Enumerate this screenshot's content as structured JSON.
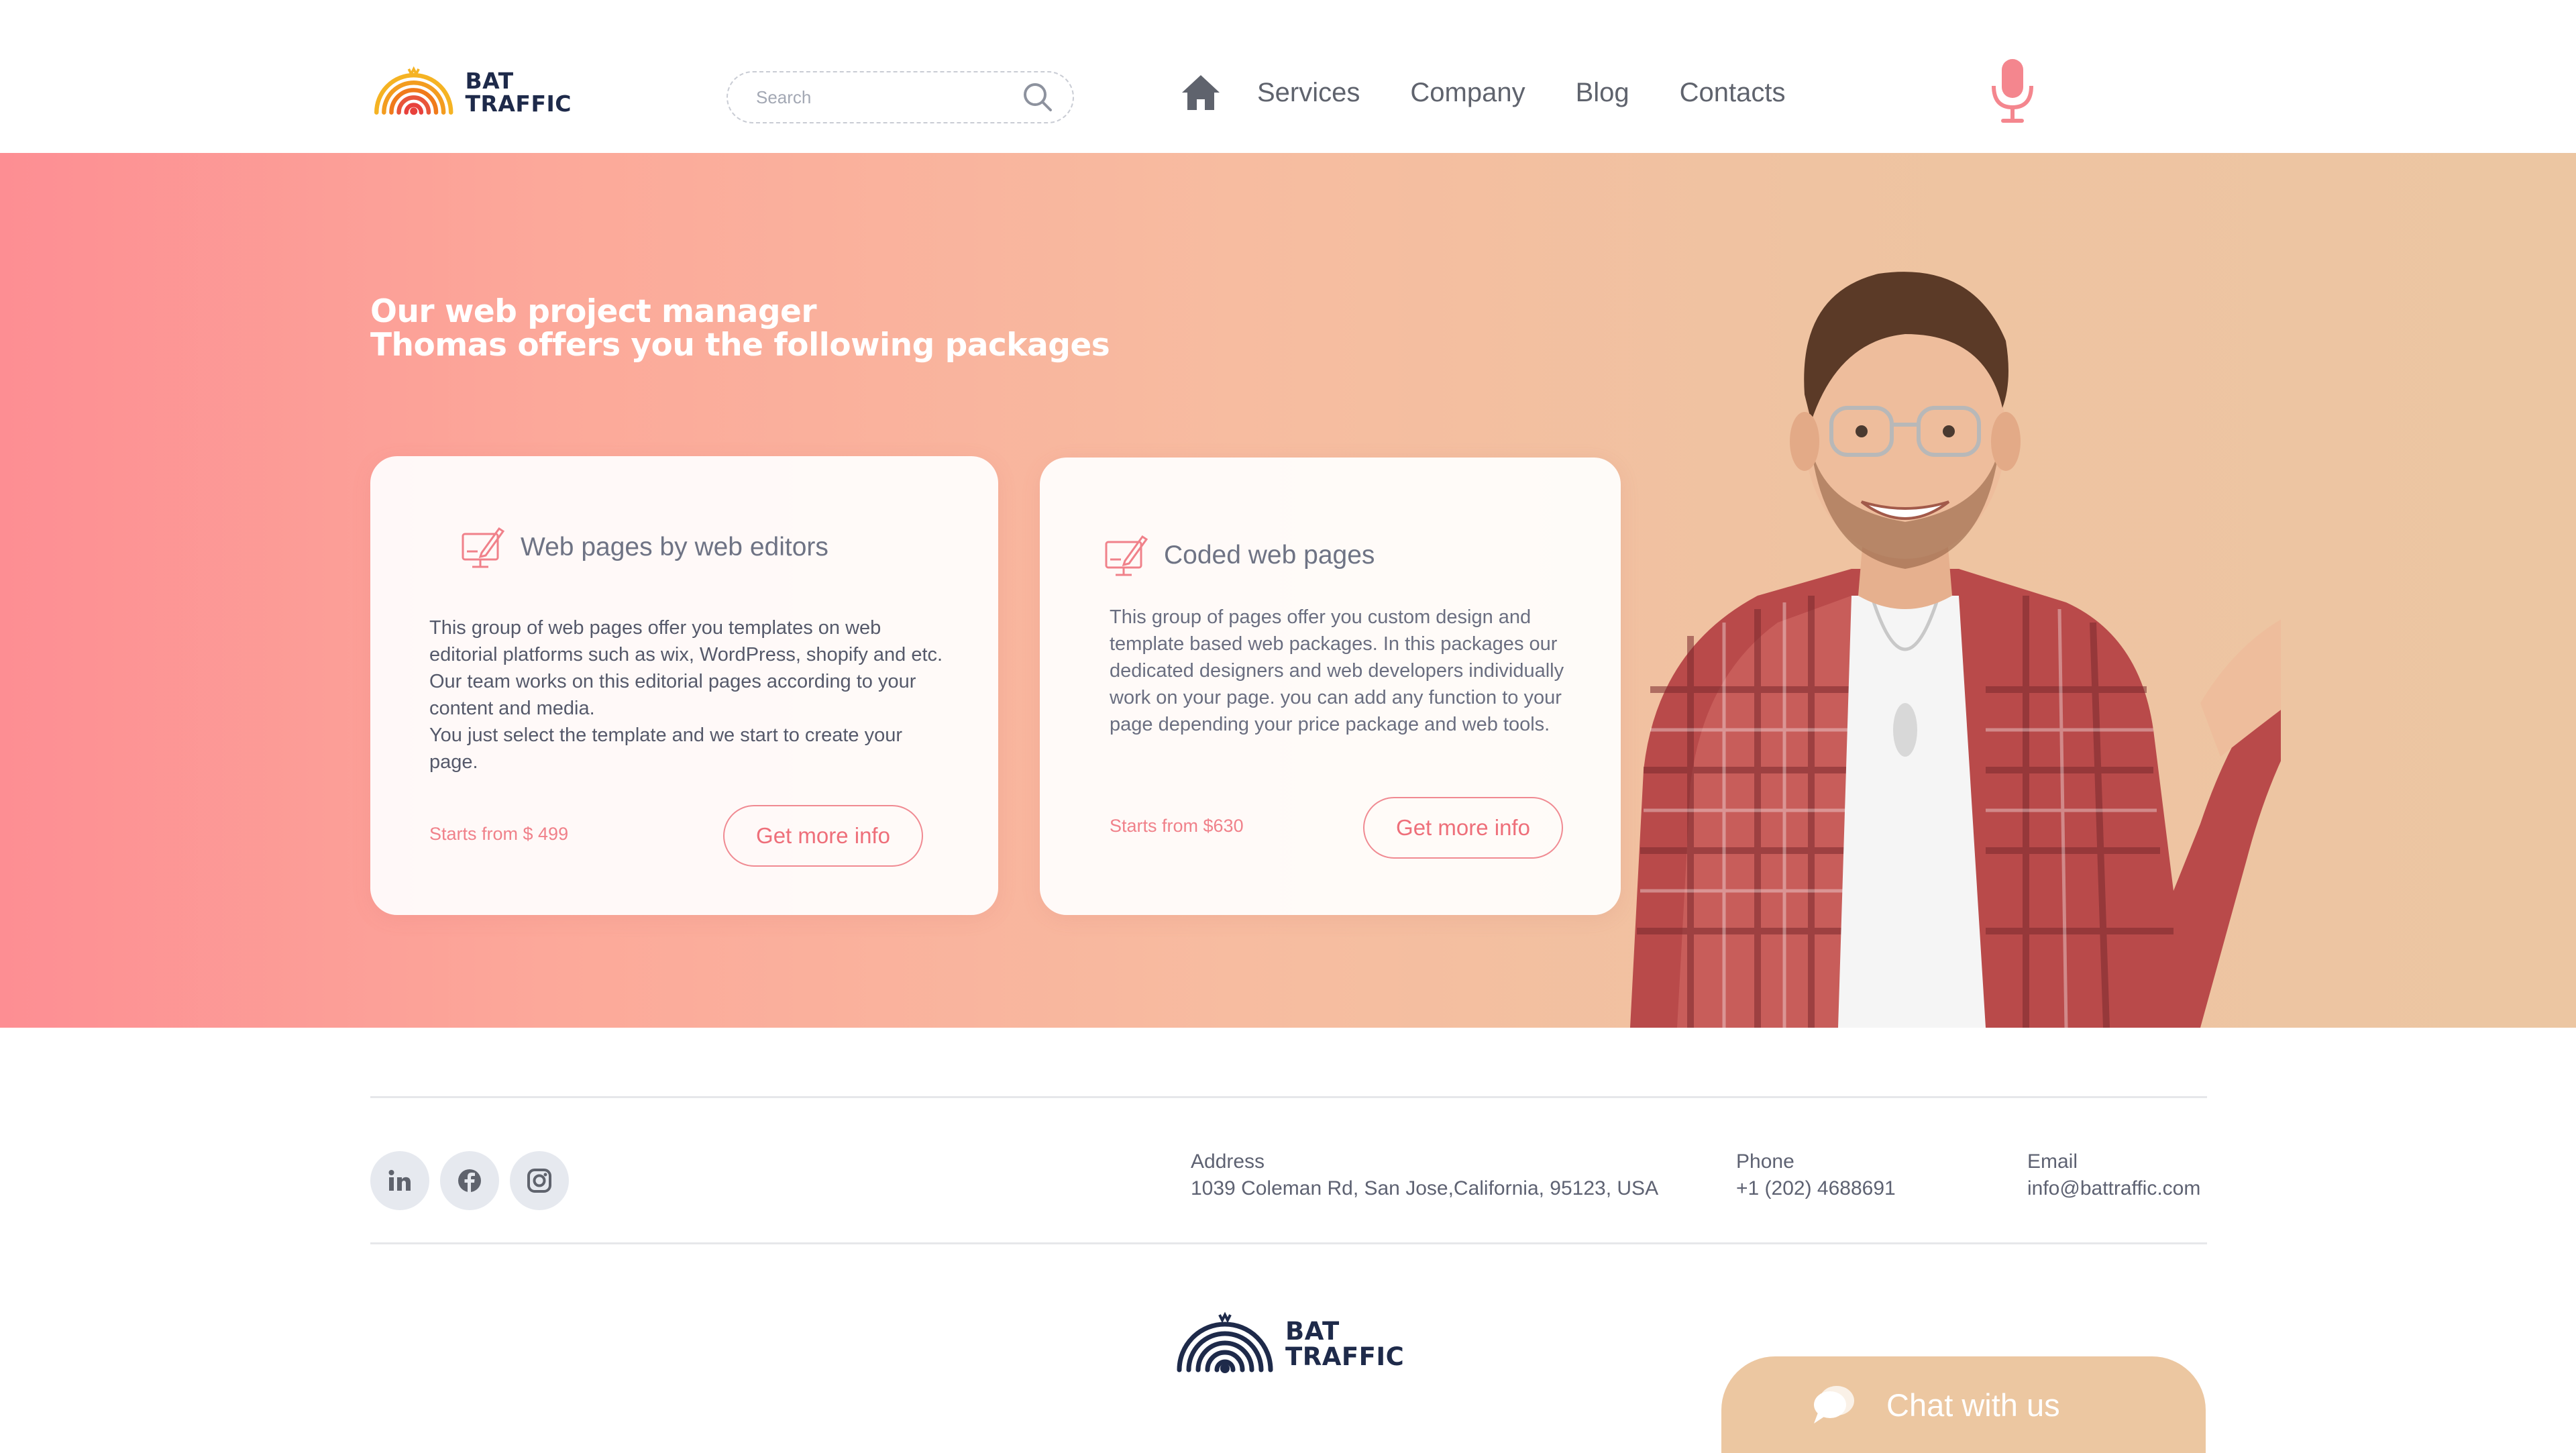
{
  "header": {
    "logo": {
      "line1": "BAT",
      "line2": "TRAFFIC",
      "colors": [
        "#f5a623",
        "#f07a1a",
        "#e8413c"
      ]
    },
    "search": {
      "placeholder": "Search",
      "value": ""
    },
    "nav": {
      "home_icon": "home-icon",
      "items": [
        "Services",
        "Company",
        "Blog",
        "Contacts"
      ]
    },
    "mic_icon": "microphone-icon"
  },
  "hero": {
    "title_line1": "Our web project manager",
    "title_line2": "Thomas offers you the following packages",
    "gradient": [
      "#fd8e93",
      "#ecc6a2"
    ],
    "cards": [
      {
        "icon": "desktop-design-icon",
        "title": "Web pages by web editors",
        "description": "This group of web pages offer you templates on web editorial platforms such as wix, WordPress, shopify and etc. Our team works on this editorial pages according to your content and media.",
        "description2": "You just select the template and we start to create your page.",
        "price": "Starts from $ 499",
        "button": "Get more info"
      },
      {
        "icon": "desktop-design-icon",
        "title": "Coded web pages",
        "description": "This group of pages offer you custom design and template based web packages. In this packages our dedicated designers and web developers individually work on your page. you can add any function to your page depending your price package and web tools.",
        "price": "Starts from $630",
        "button": "Get more info"
      }
    ]
  },
  "footer": {
    "socials": [
      "linkedin-icon",
      "facebook-icon",
      "instagram-icon"
    ],
    "address": {
      "label": "Address",
      "value": "1039 Coleman Rd, San Jose,California,  95123, USA"
    },
    "phone": {
      "label": "Phone",
      "value": "+1 (202) 4688691"
    },
    "email": {
      "label": "Email",
      "value": "info@battraffic.com"
    },
    "logo": {
      "line1": "BAT",
      "line2": "TRAFFIC"
    },
    "chat": {
      "label": "Chat with us",
      "color": "#ecc7a1"
    }
  },
  "colors": {
    "accent": "#ee6f7a",
    "text": "#5f636d",
    "dark": "#1e2a4a"
  }
}
